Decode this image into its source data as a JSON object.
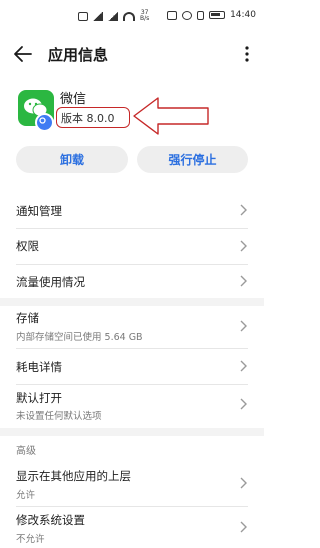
{
  "status_bar": {
    "network_speed_value": "37",
    "network_speed_unit": "B/s",
    "time": "14:40"
  },
  "header": {
    "title": "应用信息"
  },
  "app": {
    "name": "微信",
    "version": "版本 8.0.0"
  },
  "actions": {
    "uninstall": "卸载",
    "force_stop": "强行停止"
  },
  "settings": {
    "items": [
      {
        "title": "通知管理"
      },
      {
        "title": "权限"
      },
      {
        "title": "流量使用情况"
      },
      {
        "title": "存储",
        "subtitle": "内部存储空间已使用 5.64 GB"
      },
      {
        "title": "耗电详情"
      },
      {
        "title": "默认打开",
        "subtitle": "未设置任何默认选项"
      }
    ],
    "advanced_header": "高级",
    "advanced_items": [
      {
        "title": "显示在其他应用的上层",
        "subtitle": "允许"
      },
      {
        "title": "修改系统设置",
        "subtitle": "不允许"
      }
    ]
  },
  "colors": {
    "accent": "#2b6fe0",
    "annotation": "#c62828",
    "wechat_green": "#2bb741"
  },
  "icons": [
    "back-arrow-icon",
    "more-vertical-icon",
    "wechat-icon",
    "chevron-right-icon"
  ]
}
